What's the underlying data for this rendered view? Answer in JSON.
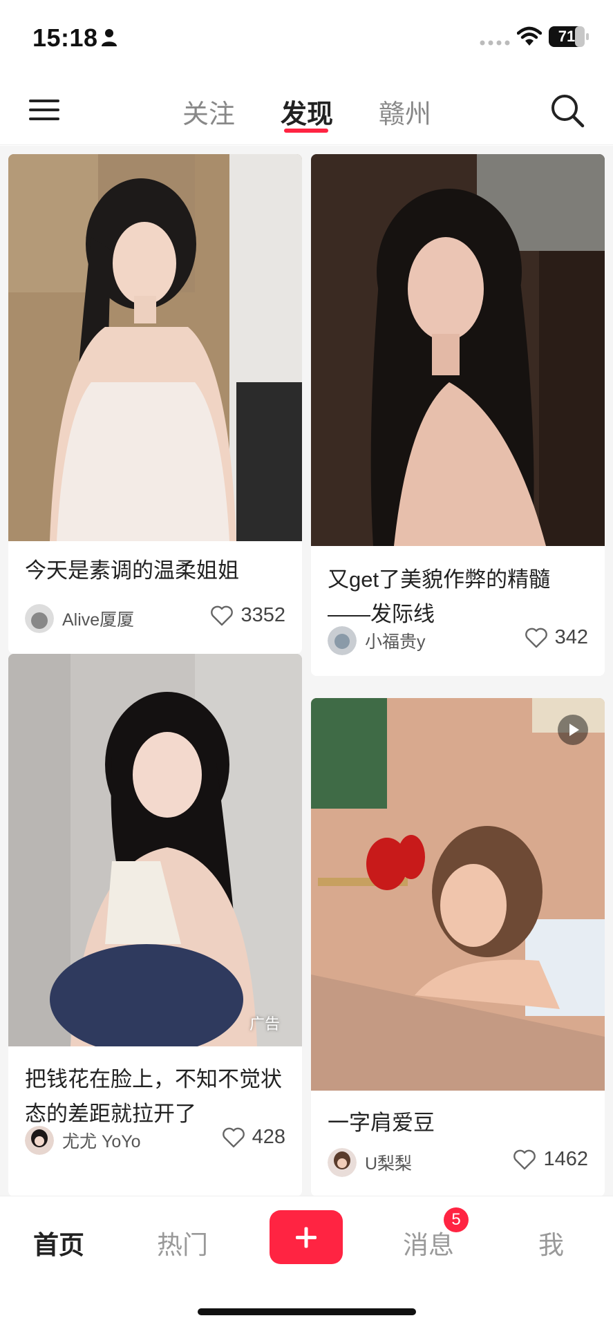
{
  "status_bar": {
    "time": "15:18",
    "battery": "71"
  },
  "top_nav": {
    "tabs": [
      {
        "label": "关注"
      },
      {
        "label": "发现"
      },
      {
        "label": "赣州"
      }
    ],
    "active_tab": "发现"
  },
  "feed": {
    "cards": [
      {
        "title": "今天是素调的温柔姐姐",
        "author": "Alive厦厦",
        "likes": "3352",
        "is_ad": false,
        "is_video": false
      },
      {
        "title": "又get了美貌作弊的精髓——发际线",
        "author": "小福贵y",
        "likes": "342",
        "is_ad": false,
        "is_video": false
      },
      {
        "title": "把钱花在脸上，不知不觉状态的差距就拉开了",
        "author": "尤尤 YoYo",
        "likes": "428",
        "is_ad": true,
        "ad_label": "广告",
        "is_video": false
      },
      {
        "title": "一字肩爱豆",
        "author": "U梨梨",
        "likes": "1462",
        "is_ad": false,
        "is_video": true
      }
    ]
  },
  "bottom_nav": {
    "items": [
      {
        "label": "首页"
      },
      {
        "label": "热门"
      },
      {
        "label": "消息"
      },
      {
        "label": "我"
      }
    ],
    "active": "首页",
    "message_badge": "5"
  },
  "colors": {
    "accent": "#ff2442",
    "text_primary": "#222222",
    "text_secondary": "#888888",
    "feed_background": "#f5f5f5"
  }
}
